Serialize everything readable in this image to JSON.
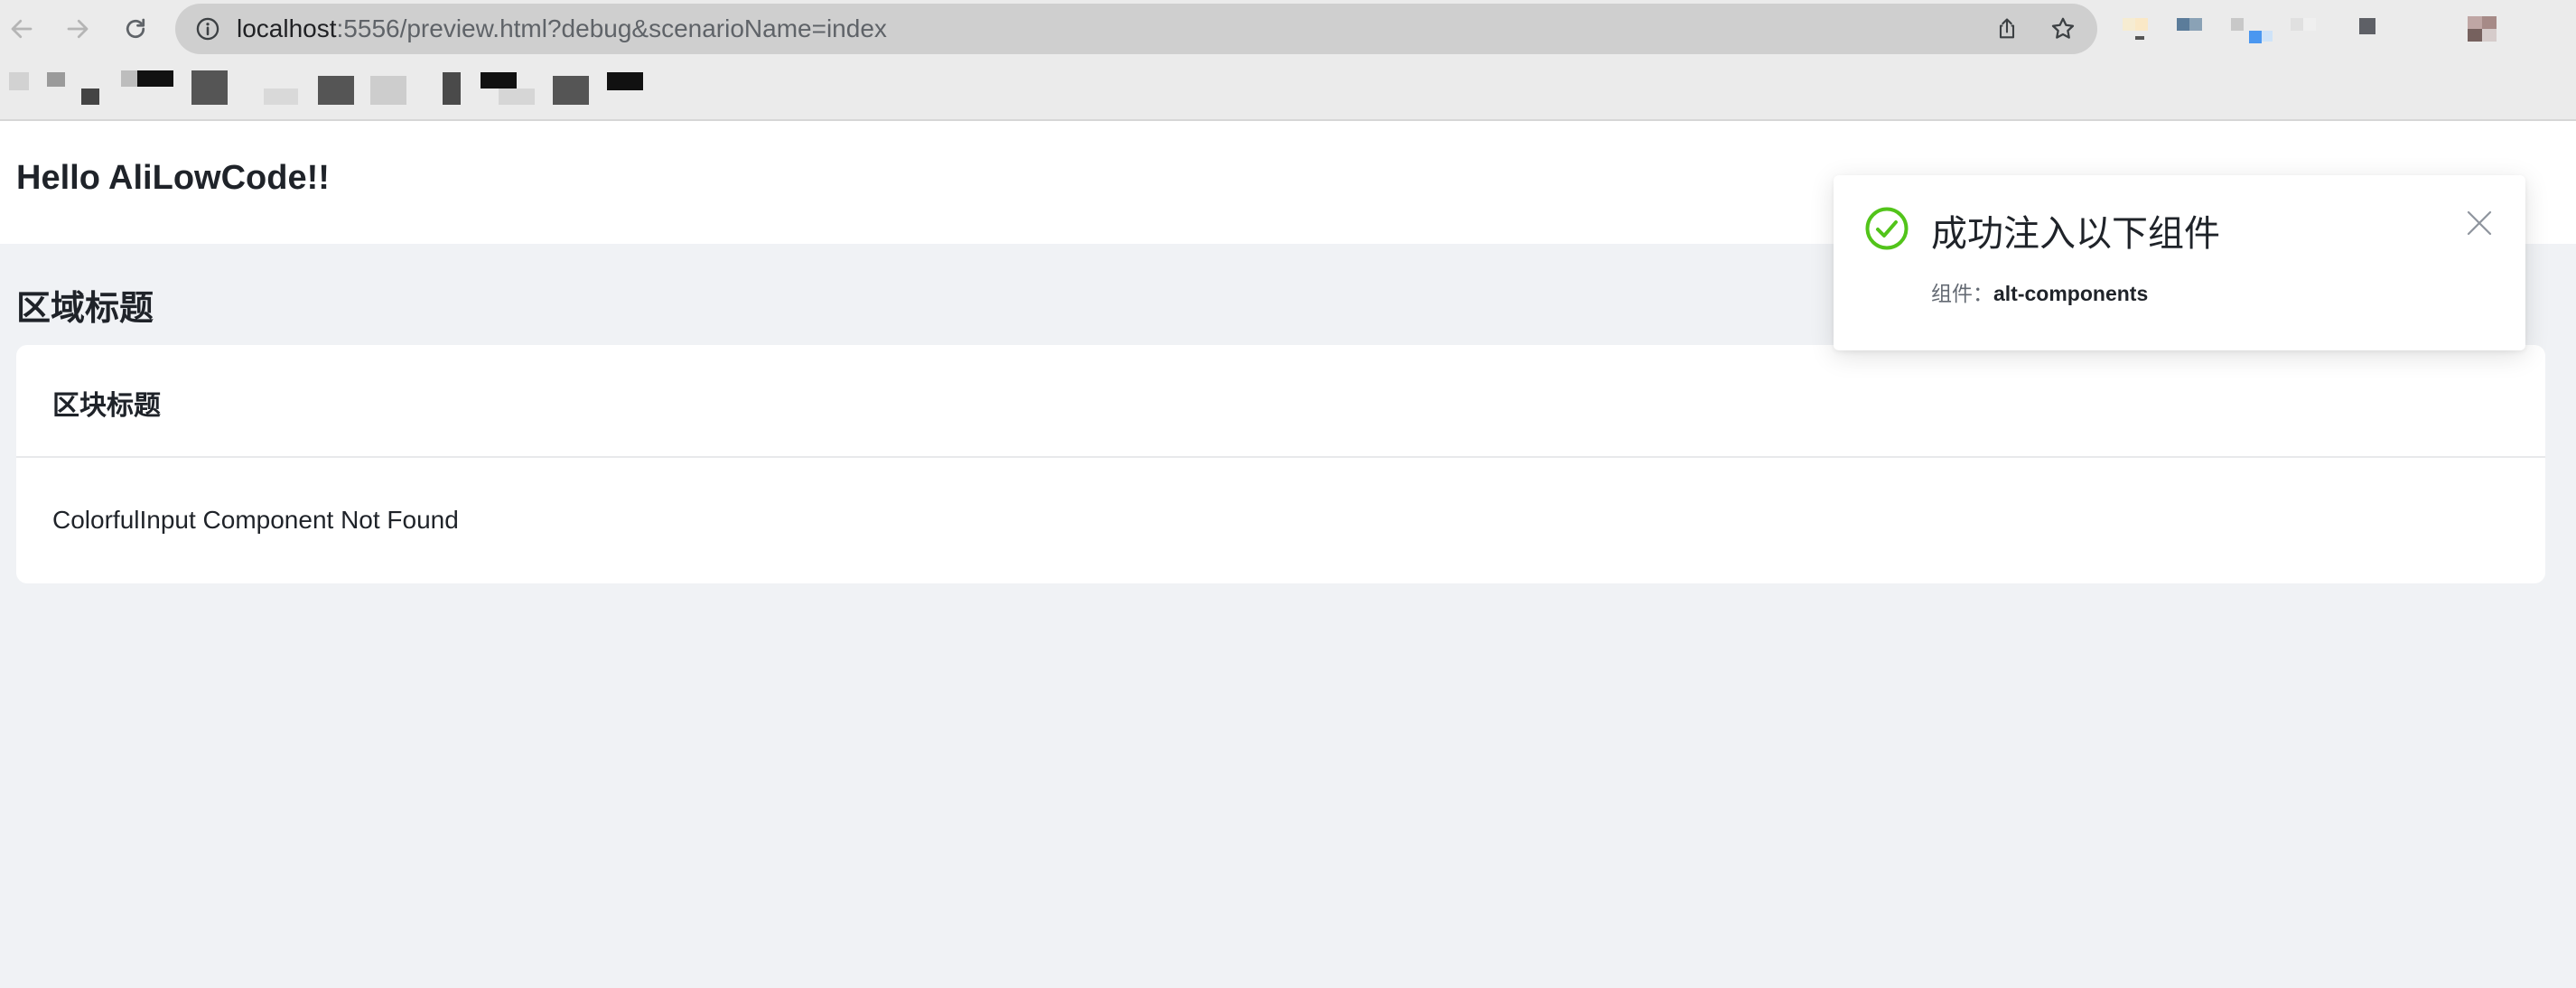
{
  "browser": {
    "url_host": "localhost",
    "url_rest": ":5556/preview.html?debug&scenarioName=index"
  },
  "page": {
    "header_title": "Hello AliLowCode!!",
    "region_title": "区域标题",
    "card": {
      "title": "区块标题",
      "body_text": "ColorfulInput Component Not Found"
    }
  },
  "notification": {
    "title": "成功注入以下组件",
    "desc_label": "组件：",
    "desc_value": "alt-components",
    "status_color": "#52c41a"
  },
  "icons": [
    "back-icon",
    "forward-icon",
    "reload-icon",
    "info-icon",
    "share-icon",
    "bookmark-star-icon",
    "success-check-icon",
    "close-icon"
  ]
}
